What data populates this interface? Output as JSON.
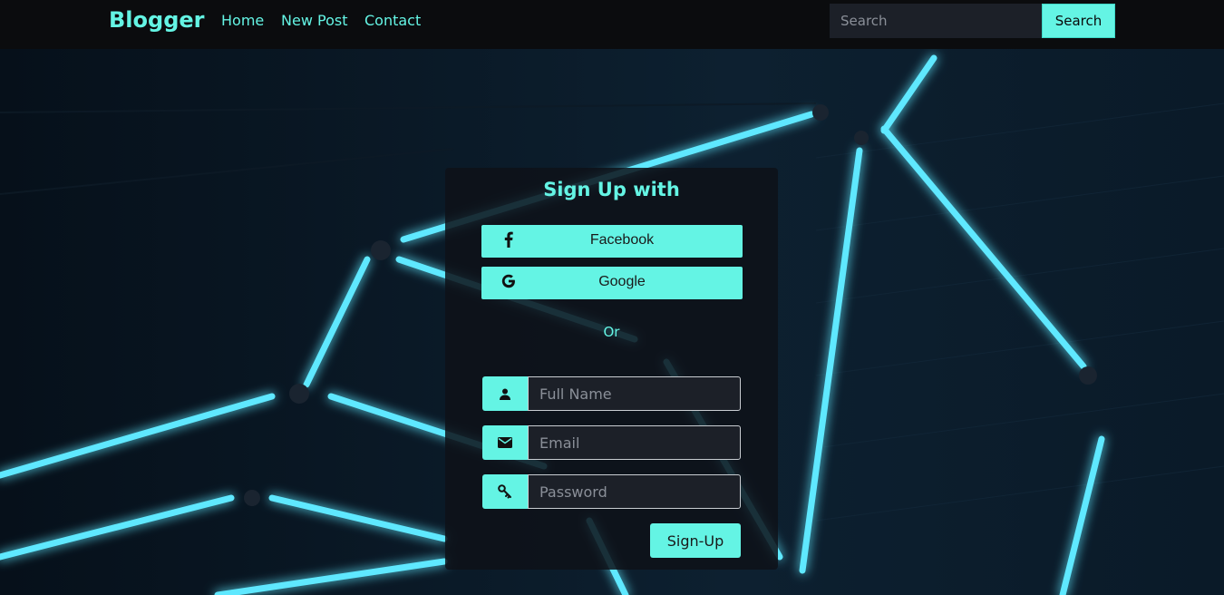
{
  "navbar": {
    "brand": "Blogger",
    "links": [
      "Home",
      "New Post",
      "Contact"
    ],
    "search_placeholder": "Search",
    "search_button": "Search"
  },
  "signup": {
    "title": "Sign Up with",
    "facebook_label": "Facebook",
    "google_label": "Google",
    "or_text": "Or",
    "full_name_placeholder": "Full Name",
    "email_placeholder": "Email",
    "password_placeholder": "Password",
    "submit_label": "Sign-Up"
  },
  "colors": {
    "accent": "#64f4e4",
    "navbar_bg": "#0b0c0e",
    "card_bg": "#0e1218",
    "input_bg": "#1c2028"
  },
  "icons": [
    "facebook-icon",
    "google-icon",
    "user-icon",
    "envelope-icon",
    "key-icon"
  ]
}
